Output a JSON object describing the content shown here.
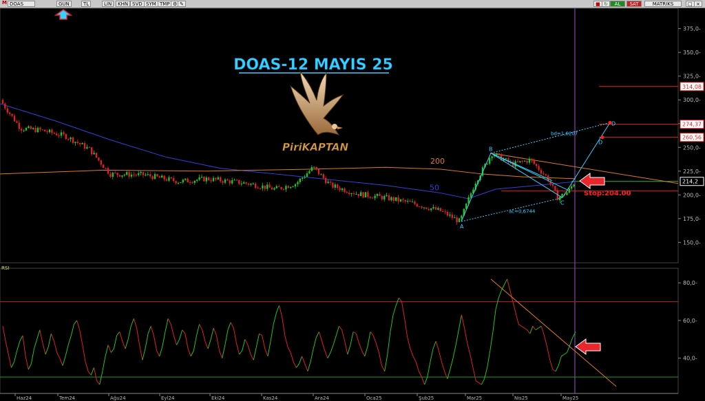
{
  "toolbar": {
    "symbol": "DOAS",
    "left_buttons": [
      "GUN",
      "TL",
      "LIN",
      "KHN",
      "SVD",
      "SYM",
      "TMP"
    ],
    "right_buttons": [
      "AL",
      "SAT",
      "MATRIKS"
    ],
    "colors": {
      "al": "#1f8a1f",
      "sat": "#c81e1e"
    }
  },
  "title": "DOAS-12 MAYIS 25",
  "logo_text": "PiriKAPTAN",
  "chart_data": [
    {
      "type": "candlestick",
      "symbol": "DOAS",
      "ylim": [
        130,
        395
      ],
      "y_ticks": [
        150,
        175,
        200,
        225,
        250,
        275,
        300,
        325,
        350,
        375
      ],
      "x_ticks": [
        "Haz24",
        "Tem24",
        "Ağu24",
        "Eyl24",
        "Eki24",
        "Kas24",
        "Ara24",
        "Oca25",
        "Şub25",
        "Mar25",
        "Nis25",
        "May25"
      ],
      "moving_averages": [
        {
          "label": "50",
          "color": "#3c3cdc"
        },
        {
          "label": "200",
          "color": "#e07a1f"
        }
      ],
      "price_labels": [
        {
          "value": 314.08,
          "text": "314,08",
          "color": "#ff2020"
        },
        {
          "value": 274.37,
          "text": "274,37",
          "color": "#ff2020"
        },
        {
          "value": 260.56,
          "text": "260,56",
          "color": "#ff2020"
        },
        {
          "value": 214.2,
          "text": "214,2",
          "color": "#ffffff"
        }
      ],
      "pattern_points": [
        {
          "label": "A",
          "value": 172
        },
        {
          "label": "B",
          "value": 244
        },
        {
          "label": "C",
          "value": 197
        },
        {
          "label": "D",
          "value": 276
        }
      ],
      "pattern_ratios": [
        "bd=1,6207",
        "ac=0,6744"
      ],
      "stop_label": "Stop:204.00",
      "stop_value": 204
    },
    {
      "type": "line",
      "title": "RSI",
      "ylim": [
        22,
        87
      ],
      "y_ticks": [
        40,
        60,
        80
      ],
      "levels": [
        70,
        30
      ],
      "series": [
        {
          "values": [
            57,
            49,
            42,
            35,
            38,
            44,
            49,
            52,
            41,
            34,
            37,
            45,
            50,
            55,
            48,
            42,
            46,
            53,
            49,
            43,
            40,
            36,
            41,
            47,
            52,
            58,
            60,
            55,
            47,
            38,
            33,
            31,
            35,
            28,
            26,
            33,
            41,
            47,
            43,
            45,
            52,
            54,
            49,
            45,
            50,
            57,
            61,
            56,
            47,
            39,
            45,
            53,
            57,
            52,
            44,
            41,
            46,
            54,
            61,
            58,
            52,
            47,
            50,
            55,
            53,
            45,
            41,
            44,
            52,
            58,
            55,
            49,
            45,
            50,
            56,
            52,
            44,
            40,
            47,
            55,
            59,
            56,
            48,
            42,
            44,
            50,
            47,
            42,
            39,
            46,
            53,
            52,
            45,
            41,
            49,
            58,
            64,
            68,
            62,
            52,
            46,
            43,
            38,
            35,
            37,
            41,
            37,
            33,
            38,
            45,
            51,
            54,
            49,
            44,
            40,
            43,
            47,
            52,
            57,
            55,
            49,
            42,
            47,
            54,
            53,
            48,
            44,
            41,
            46,
            54,
            52,
            48,
            43,
            36,
            33,
            42,
            54,
            63,
            68,
            72,
            70,
            61,
            51,
            45,
            41,
            38,
            33,
            30,
            26,
            30,
            38,
            45,
            49,
            44,
            38,
            33,
            29,
            34,
            40,
            47,
            55,
            63,
            56,
            48,
            42,
            35,
            28,
            27,
            26,
            29,
            35,
            44,
            54,
            66,
            72,
            76,
            79,
            82,
            76,
            70,
            64,
            58,
            57,
            56,
            55,
            53,
            57,
            55,
            56,
            57,
            52,
            46,
            39,
            34,
            33,
            36,
            41,
            42,
            43,
            47,
            51,
            54
          ]
        }
      ]
    }
  ]
}
